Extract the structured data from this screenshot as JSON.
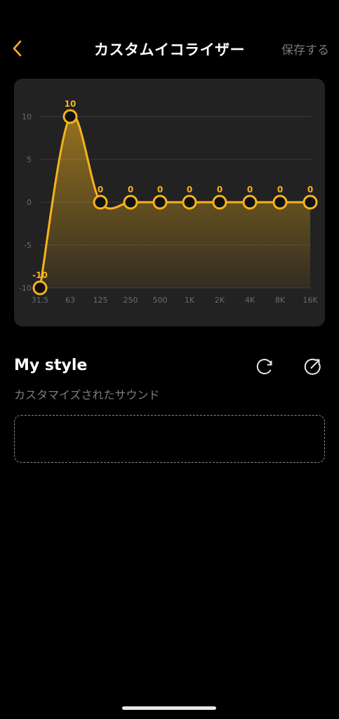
{
  "header": {
    "title": "カスタムイコライザー",
    "save_label": "保存する",
    "back_icon": "chevron-left-icon"
  },
  "colors": {
    "accent": "#F5B31C",
    "background": "#000000",
    "card": "#222222",
    "muted_text": "#7D7D7D"
  },
  "chart_data": {
    "type": "line",
    "x": [
      "31.5",
      "63",
      "125",
      "250",
      "500",
      "1K",
      "2K",
      "4K",
      "8K",
      "16K"
    ],
    "values": [
      -10,
      10,
      0,
      0,
      0,
      0,
      0,
      0,
      0,
      0
    ],
    "point_labels": [
      "-10",
      "10",
      "0",
      "0",
      "0",
      "0",
      "0",
      "0",
      "0",
      "0"
    ],
    "y_ticks": [
      "10",
      "5",
      "0",
      "-5",
      "-10"
    ],
    "ylim": [
      -10,
      10
    ],
    "grid": true,
    "smoothed": true,
    "area_fill": true
  },
  "style": {
    "title": "My style",
    "subtitle": "カスタマイズされたサウンド",
    "reset_icon": "refresh-icon",
    "share_icon": "share-icon"
  }
}
